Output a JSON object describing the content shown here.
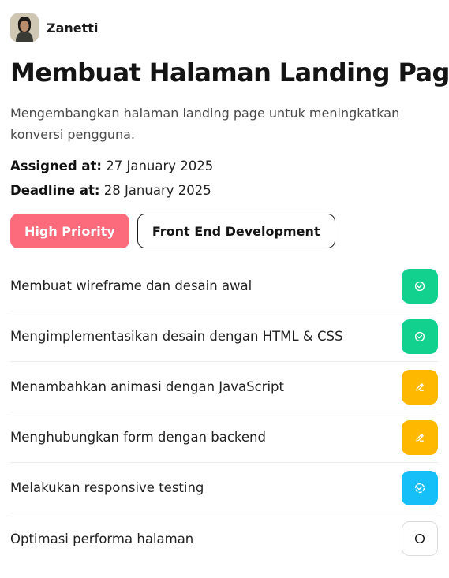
{
  "author": {
    "name": "Zanetti",
    "avatar_icon": "user-avatar-photo"
  },
  "task": {
    "title": "Membuat Halaman Landing Page",
    "description": "Mengembangkan halaman landing page untuk meningkatkan konversi pengguna.",
    "assigned_label": "Assigned at:",
    "assigned_value": "27 January 2025",
    "deadline_label": "Deadline at:",
    "deadline_value": "28 January 2025"
  },
  "tags": {
    "priority": "High Priority",
    "category": "Front End Development"
  },
  "colors": {
    "priority": "#fb6b7c",
    "done": "#12d18e",
    "in_progress": "#ffb800",
    "review": "#16bff7"
  },
  "subtasks": [
    {
      "label": "Membuat wireframe dan desain awal",
      "status": "done",
      "icon": "check-circle-icon"
    },
    {
      "label": "Mengimplementasikan desain dengan HTML & CSS",
      "status": "done",
      "icon": "check-circle-icon"
    },
    {
      "label": "Menambahkan animasi dengan JavaScript",
      "status": "in-progress",
      "icon": "pencil-icon"
    },
    {
      "label": "Menghubungkan form dengan backend",
      "status": "in-progress",
      "icon": "pencil-icon"
    },
    {
      "label": "Melakukan responsive testing",
      "status": "review",
      "icon": "check-dashed-circle-icon"
    },
    {
      "label": "Optimasi performa halaman",
      "status": "todo",
      "icon": "circle-icon"
    }
  ]
}
